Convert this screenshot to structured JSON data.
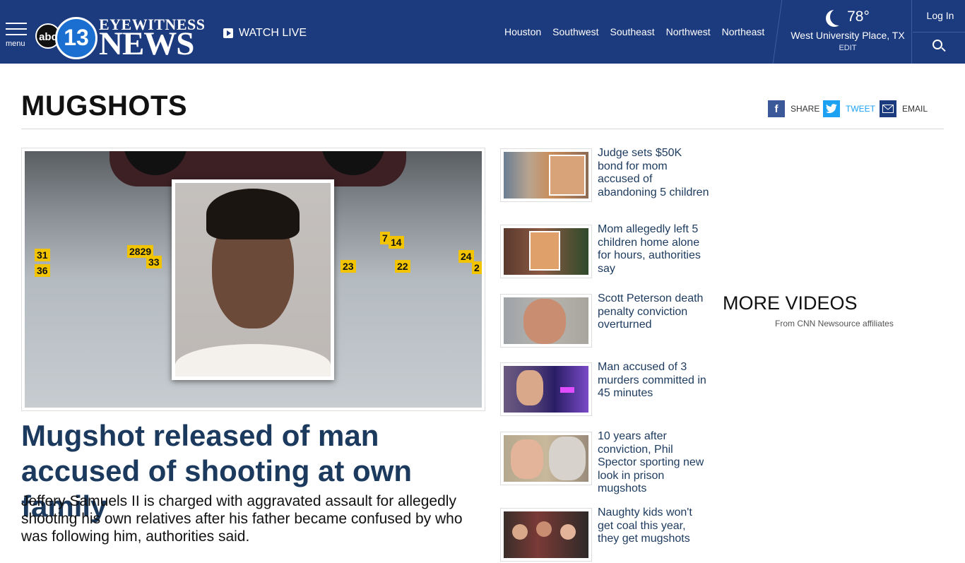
{
  "header": {
    "menu_label": "menu",
    "logo": {
      "abc": "abc",
      "number": "13",
      "line1": "EYEWITNESS",
      "line2": "NEWS"
    },
    "watch_live": "WATCH LIVE",
    "regions": [
      "Houston",
      "Southwest",
      "Southeast",
      "Northwest",
      "Northeast"
    ],
    "weather": {
      "temp": "78°",
      "location": "West University Place, TX",
      "edit": "EDIT",
      "icon": "moon-icon"
    },
    "login": "Log In",
    "search_icon": "search-icon"
  },
  "page": {
    "title": "MUGSHOTS",
    "share": {
      "facebook": "SHARE",
      "twitter": "TWEET",
      "email": "EMAIL"
    }
  },
  "hero": {
    "title": "Mugshot released of man accused of shooting at own family",
    "description": "Jeffery Samuels II is charged with aggravated assault for allegedly shooting his own relatives after his father became confused by who was following him, authorities said.",
    "markers": [
      "31",
      "36",
      "2829",
      "33",
      "7",
      "14",
      "23",
      "22",
      "24",
      "2"
    ]
  },
  "stories": [
    {
      "title": "Judge sets $50K bond for mom accused of abandoning 5 children"
    },
    {
      "title": "Mom allegedly left 5 children home alone for hours, authorities say"
    },
    {
      "title": "Scott Peterson death penalty conviction overturned"
    },
    {
      "title": "Man accused of 3 murders committed in 45 minutes"
    },
    {
      "title": "10 years after conviction, Phil Spector sporting new look in prison mugshots"
    },
    {
      "title": "Naughty kids won't get coal this year, they get mugshots"
    }
  ],
  "more_videos": {
    "title": "MORE VIDEOS",
    "subtitle": "From CNN Newsource affiliates"
  },
  "colors": {
    "header_bg": "#1c3a7e",
    "headline": "#1c3a5e",
    "facebook": "#3b5998",
    "twitter": "#1da1f2",
    "marker": "#f2c400"
  }
}
